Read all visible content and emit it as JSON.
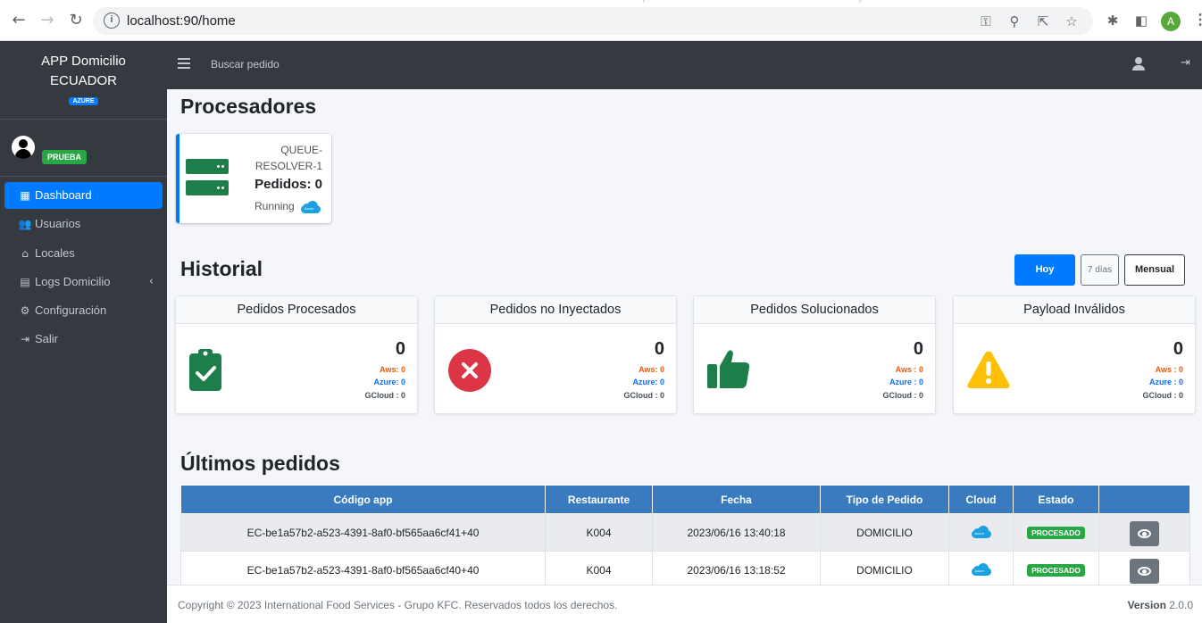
{
  "browser": {
    "url": "localhost:90/home",
    "profile_initial": "A"
  },
  "sidebar": {
    "brand_line1": "APP Domicilio",
    "brand_line2": "ECUADOR",
    "brand_badge": "AZURE",
    "user_badge": "PRUEBA",
    "items": [
      {
        "label": "Dashboard",
        "icon": "table-icon",
        "active": true
      },
      {
        "label": "Usuarios",
        "icon": "users-icon"
      },
      {
        "label": "Locales",
        "icon": "store-icon"
      },
      {
        "label": "Logs Domicilio",
        "icon": "archive-icon"
      },
      {
        "label": "Configuración",
        "icon": "cogs-icon"
      },
      {
        "label": "Salir",
        "icon": "sign-out-icon"
      }
    ]
  },
  "topnav": {
    "search_label": "Buscar pedido"
  },
  "processors": {
    "title": "Procesadores",
    "card": {
      "name": "QUEUE-RESOLVER-1",
      "count_label": "Pedidos: 0",
      "status": "Running",
      "cloud_label": "Azure"
    }
  },
  "historial": {
    "title": "Historial",
    "buttons": {
      "today": "Hoy",
      "week": "7 días",
      "month": "Mensual"
    },
    "cards": [
      {
        "title": "Pedidos Procesados",
        "value": "0",
        "aws": "Aws: 0",
        "azure": "Azure: 0",
        "gcloud": "GCloud : 0",
        "icon": "clipboard-check-icon",
        "color": "#1e7e4a"
      },
      {
        "title": "Pedidos no Inyectados",
        "value": "0",
        "aws": "Aws: 0",
        "azure": "Azure: 0",
        "gcloud": "GCloud : 0",
        "icon": "times-circle-icon",
        "color": "#dc3545"
      },
      {
        "title": "Pedidos Solucionados",
        "value": "0",
        "aws": "Aws : 0",
        "azure": "Azure : 0",
        "gcloud": "GCloud : 0",
        "icon": "thumbs-up-icon",
        "color": "#1e7e4a"
      },
      {
        "title": "Payload Inválidos",
        "value": "0",
        "aws": "Aws : 0",
        "azure": "Azure : 0",
        "gcloud": "GCloud : 0",
        "icon": "warning-icon",
        "color": "#ffc107"
      }
    ]
  },
  "orders": {
    "title": "Últimos pedidos",
    "columns": [
      "Código app",
      "Restaurante",
      "Fecha",
      "Tipo de Pedido",
      "Cloud",
      "Estado",
      ""
    ],
    "rows": [
      {
        "code": "EC-be1a57b2-a523-4391-8af0-bf565aa6cf41+40",
        "restaurant": "K004",
        "date": "2023/06/16 13:40:18",
        "type": "DOMICILIO",
        "cloud": "Azure",
        "state": "PROCESADO"
      },
      {
        "code": "EC-be1a57b2-a523-4391-8af0-bf565aa6cf40+40",
        "restaurant": "K004",
        "date": "2023/06/16 13:18:52",
        "type": "DOMICILIO",
        "cloud": "Azure",
        "state": "PROCESADO"
      }
    ]
  },
  "footer": {
    "copyright": "Copyright © 2023 International Food Services - Grupo KFC. Reservados todos los derechos.",
    "version_label": "Version",
    "version_value": "2.0.0"
  }
}
